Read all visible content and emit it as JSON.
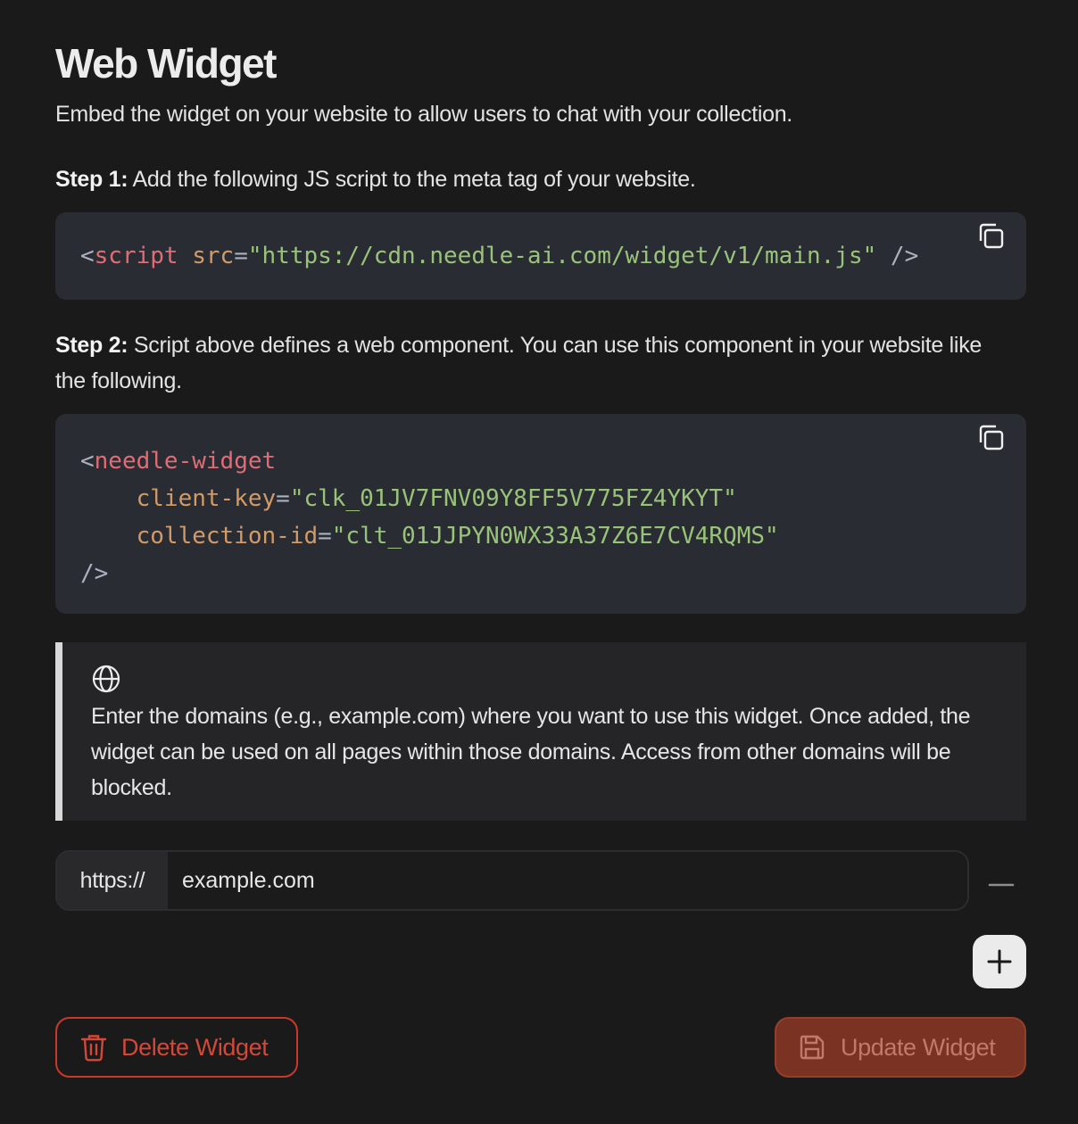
{
  "header": {
    "title": "Web Widget",
    "subtitle": "Embed the widget on your website to allow users to chat with your collection."
  },
  "step1": {
    "label": "Step 1:",
    "text": " Add the following JS script to the meta tag of your website.",
    "code": {
      "open": "<",
      "tag": "script",
      "attr": "src",
      "eq": "=",
      "value": "\"https://cdn.needle-ai.com/widget/v1/main.js\"",
      "close": " />"
    }
  },
  "step2": {
    "label": "Step 2:",
    "text": " Script above defines a web component. You can use this component in your website like the following.",
    "code": {
      "open": "<",
      "tag": "needle-widget",
      "attr1": "client-key",
      "value1": "\"clk_01JV7FNV09Y8FF5V775FZ4YKYT\"",
      "attr2": "collection-id",
      "value2": "\"clt_01JJPYN0WX33A37Z6E7CV4RQMS\"",
      "eq": "=",
      "close": "/>"
    }
  },
  "callout": {
    "icon": "globe-icon",
    "text": "Enter the domains (e.g., example.com) where you want to use this widget. Once added, the widget can be used on all pages within those domains. Access from other domains will be blocked."
  },
  "domains": {
    "prefix": "https://",
    "value": "example.com"
  },
  "actions": {
    "delete_label": "Delete Widget",
    "update_label": "Update Widget"
  },
  "colors": {
    "danger": "#d44838",
    "update_bg": "#7a3323",
    "code_bg": "#2a2c33"
  }
}
